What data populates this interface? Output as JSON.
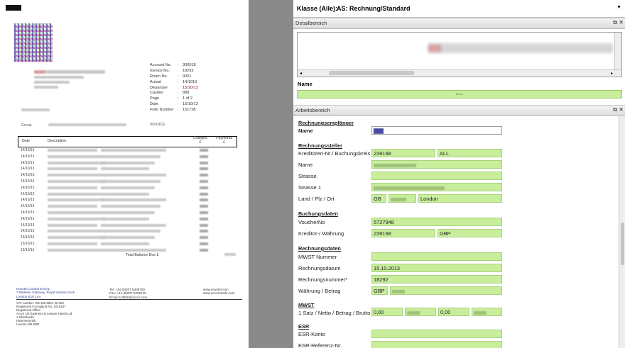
{
  "invoice": {
    "meta_rows": [
      {
        "key": "Account No.",
        "value": "300018"
      },
      {
        "key": "Invoice No.",
        "value": "18292"
      },
      {
        "key": "Room No.",
        "value": "9021"
      },
      {
        "key": "Arrival",
        "value": "14/1013"
      },
      {
        "key": "Departure",
        "value": "15/10/13"
      },
      {
        "key": "Cashier",
        "value": "888"
      },
      {
        "key": "Page",
        "value": "1 of 2"
      },
      {
        "key": "Date",
        "value": "15/10/13"
      },
      {
        "key": "Folio Number",
        "value": "151736"
      }
    ],
    "doc_type": "INVOICE",
    "group_label": "Group",
    "table_headers": {
      "date": "Date",
      "description": "Description",
      "charges": "Charges\n£",
      "payments": "Payments\n£"
    },
    "dates": [
      "14/10/13",
      "14/10/13",
      "14/10/13",
      "14/10/13",
      "14/10/13",
      "14/10/13",
      "14/10/13",
      "14/10/13",
      "14/10/13",
      "14/10/13",
      "14/10/13",
      "14/10/13",
      "14/10/13",
      "14/10/13",
      "15/10/13",
      "15/10/13",
      "15/10/13"
    ],
    "total_label": "Total Balance Due £",
    "footer_left": [
      "Novotel London ExCeL",
      "7 Western Gateway, Royal Victoria Dock",
      "London E16 1AA"
    ],
    "footer_mid": [
      "Tel:  +44 (0)207 5409700",
      "Fax:  +44 (0)207 5409710",
      "Email: H3656@accor.com"
    ],
    "footer_right": [
      "www.novotel.com",
      "www.accorhotels.com"
    ],
    "footer_bottom": [
      "VAT number: GB 156 0921 42 000",
      "Registered in England No. 1016187",
      "Registered Office",
      "Accor UK Business & Leisure Hotels Ltd",
      "1 Shortlands",
      "Hammersmith",
      "London W6 8DR"
    ]
  },
  "header": {
    "class_label": "Klasse (Alle):",
    "class_value": "AS: Rechnung/Standard",
    "dropdown_icon": "triangle-down-icon"
  },
  "detail_panel": {
    "title": "Detailbereich",
    "name_label": "Name",
    "name_value": "Beleh"
  },
  "work_panel": {
    "title": "Arbeitsbereich",
    "recipient": {
      "section": "Rechnungsempfänger",
      "name_label": "Name"
    },
    "issuer": {
      "section": "Rechnungssteller",
      "creditor_label": "Kreditoren-Nr./ Buchungskreis",
      "creditor_value": "239168",
      "company_code": "ALL",
      "name_label": "Name",
      "street_label": "Strasse",
      "street1_label": "Strasse 1",
      "country_label": "Land / Plz / Ort",
      "country_value": "GB",
      "city_value": "London"
    },
    "booking": {
      "section": "Buchungsdaten",
      "voucher_label": "VoucherNo",
      "voucher_value": "5727948",
      "creditor_currency_label": "Kreditor-/ Währung",
      "creditor_value": "239168",
      "currency_value": "GBP"
    },
    "invoice": {
      "section": "Rechnungsdaten",
      "vat_label": "MWST Nummer",
      "date_label": "Rechnungsdatum",
      "date_value": "15.10.2013",
      "number_label": "Rechnungsnummer*",
      "number_value": "18292",
      "currency_amount_label": "Währung / Betrag",
      "currency_value": "GBP"
    },
    "vat": {
      "section": "MWST",
      "rate_label": "1 Satz / Netto / Betrag / Brutto",
      "rate_value": "0,00",
      "amount_value": "0,00"
    },
    "esr": {
      "section": "ESR",
      "account_label": "ESR-Konto",
      "ref_label": "ESR-Referenz-Nr."
    }
  },
  "colors": {
    "field_green": "#c8ee9c",
    "panel_header": "#e6e6e6",
    "gutter": "#8a8a8a"
  }
}
